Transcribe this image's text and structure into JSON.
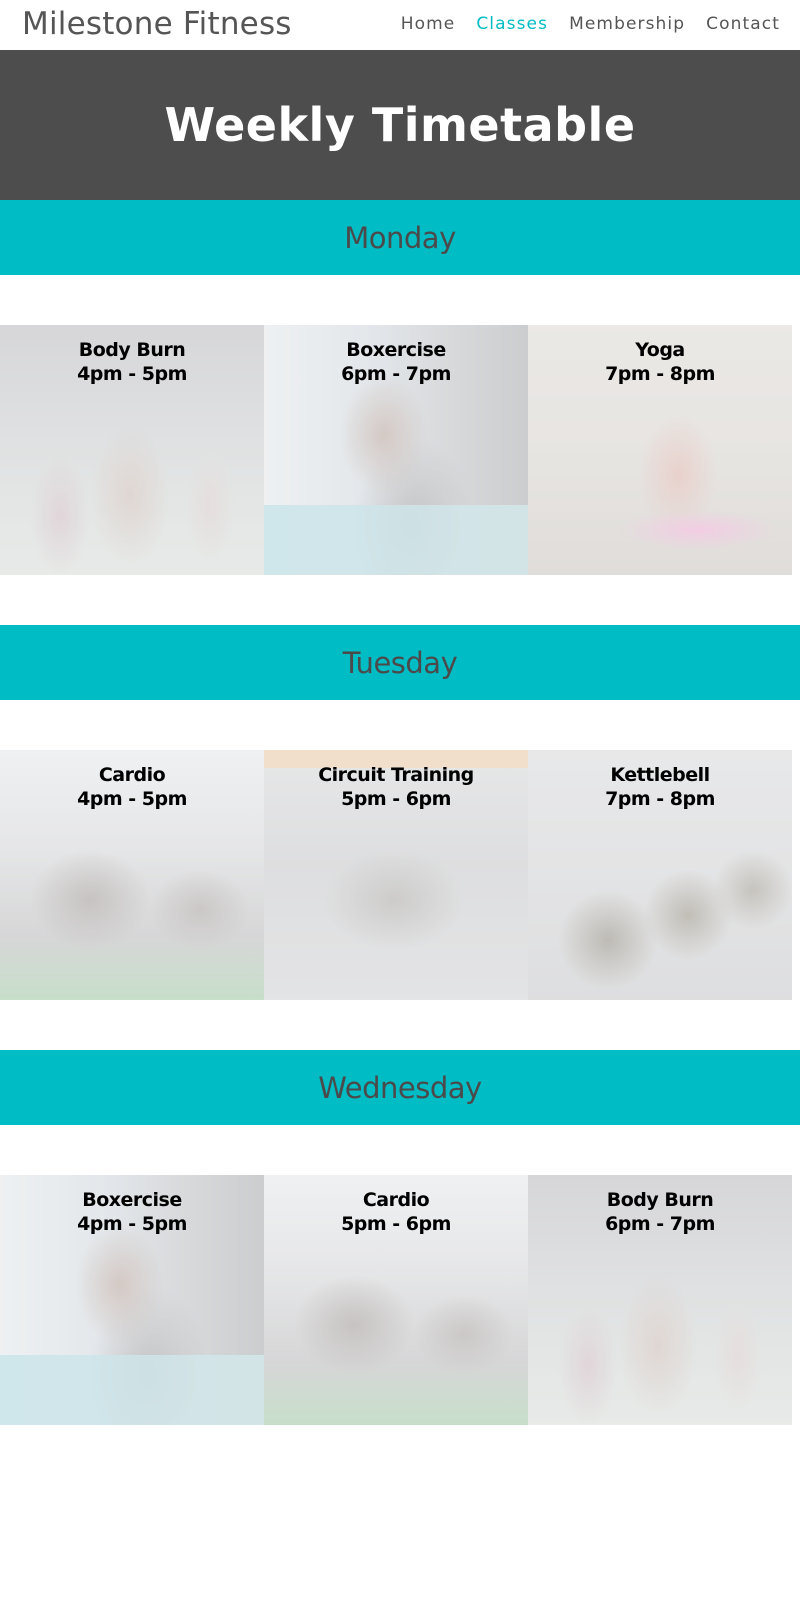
{
  "header": {
    "brand": "Milestone Fitness",
    "nav": [
      {
        "label": "Home",
        "active": false
      },
      {
        "label": "Classes",
        "active": true
      },
      {
        "label": "Membership",
        "active": false
      },
      {
        "label": "Contact",
        "active": false
      }
    ]
  },
  "hero": {
    "title": "Weekly Timetable"
  },
  "days": [
    {
      "name": "Monday",
      "classes": [
        {
          "name": "Body Burn",
          "time": "4pm - 5pm",
          "image": "body-burn-photo"
        },
        {
          "name": "Boxercise",
          "time": "6pm - 7pm",
          "image": "boxercise-photo"
        },
        {
          "name": "Yoga",
          "time": "7pm - 8pm",
          "image": "yoga-photo"
        }
      ]
    },
    {
      "name": "Tuesday",
      "classes": [
        {
          "name": "Cardio",
          "time": "4pm - 5pm",
          "image": "cardio-photo"
        },
        {
          "name": "Circuit Training",
          "time": "5pm - 6pm",
          "image": "circuit-training-photo"
        },
        {
          "name": "Kettlebell",
          "time": "7pm - 8pm",
          "image": "kettlebell-photo"
        }
      ]
    },
    {
      "name": "Wednesday",
      "classes": [
        {
          "name": "Boxercise",
          "time": "4pm - 5pm",
          "image": "boxercise-photo"
        },
        {
          "name": "Cardio",
          "time": "5pm - 6pm",
          "image": "cardio-photo"
        },
        {
          "name": "Body Burn",
          "time": "6pm - 7pm",
          "image": "body-burn-photo"
        }
      ]
    }
  ],
  "colors": {
    "accent": "#00bcc5",
    "hero_bg": "#4d4d4d",
    "text_dark": "#4a4a4a"
  }
}
